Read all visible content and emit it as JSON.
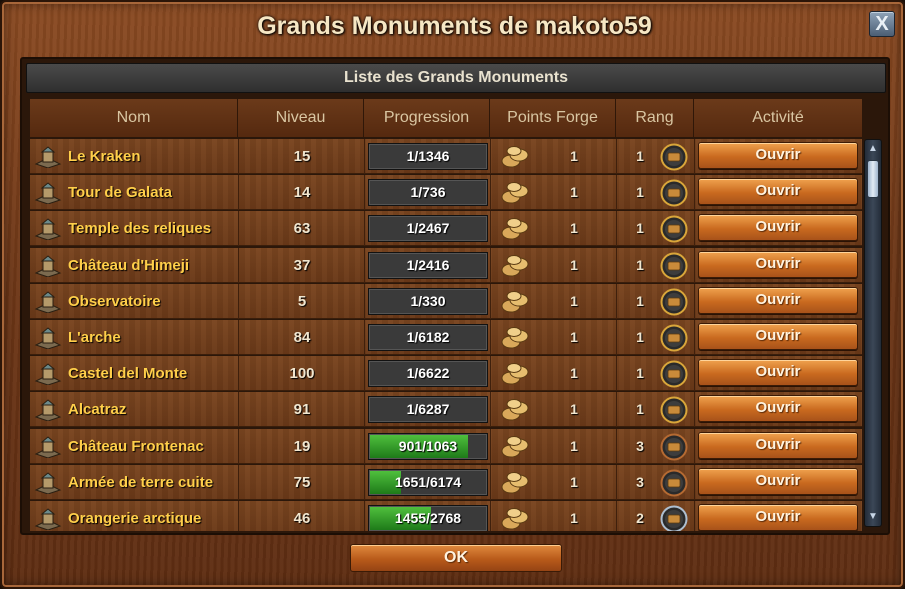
{
  "window": {
    "title": "Grands Monuments de makoto59",
    "close_label": "X"
  },
  "subheader": "Liste des Grands Monuments",
  "columns": {
    "name": "Nom",
    "level": "Niveau",
    "progress": "Progression",
    "forge_points": "Points Forge",
    "rank": "Rang",
    "activity": "Activité"
  },
  "rows": [
    {
      "name": "Le Kraken",
      "level": "15",
      "progress": "1/1346",
      "fill": 0.0,
      "forge_points": "1",
      "rank": "1",
      "button": "Ouvrir",
      "icon": "kraken-icon",
      "medal": "gold"
    },
    {
      "name": "Tour de Galata",
      "level": "14",
      "progress": "1/736",
      "fill": 0.0,
      "forge_points": "1",
      "rank": "1",
      "button": "Ouvrir",
      "icon": "tower-icon",
      "medal": "gold"
    },
    {
      "name": "Temple des reliques",
      "level": "63",
      "progress": "1/2467",
      "fill": 0.0,
      "forge_points": "1",
      "rank": "1",
      "button": "Ouvrir",
      "icon": "temple-icon",
      "medal": "gold"
    },
    {
      "name": "Château d'Himeji",
      "level": "37",
      "progress": "1/2416",
      "fill": 0.0,
      "forge_points": "1",
      "rank": "1",
      "button": "Ouvrir",
      "icon": "castle-icon",
      "medal": "gold"
    },
    {
      "name": "Observatoire",
      "level": "5",
      "progress": "1/330",
      "fill": 0.0,
      "forge_points": "1",
      "rank": "1",
      "button": "Ouvrir",
      "icon": "observatory-icon",
      "medal": "gold"
    },
    {
      "name": "L'arche",
      "level": "84",
      "progress": "1/6182",
      "fill": 0.0,
      "forge_points": "1",
      "rank": "1",
      "button": "Ouvrir",
      "icon": "arch-icon",
      "medal": "gold"
    },
    {
      "name": "Castel del Monte",
      "level": "100",
      "progress": "1/6622",
      "fill": 0.0,
      "forge_points": "1",
      "rank": "1",
      "button": "Ouvrir",
      "icon": "fortress-icon",
      "medal": "gold"
    },
    {
      "name": "Alcatraz",
      "level": "91",
      "progress": "1/6287",
      "fill": 0.0,
      "forge_points": "1",
      "rank": "1",
      "button": "Ouvrir",
      "icon": "prison-icon",
      "medal": "gold"
    },
    {
      "name": "Château Frontenac",
      "level": "19",
      "progress": "901/1063",
      "fill": 0.848,
      "forge_points": "1",
      "rank": "3",
      "button": "Ouvrir",
      "icon": "hotel-castle-icon",
      "medal": "bronze"
    },
    {
      "name": "Armée de terre cuite",
      "level": "75",
      "progress": "1651/6174",
      "fill": 0.267,
      "forge_points": "1",
      "rank": "3",
      "button": "Ouvrir",
      "icon": "terracotta-icon",
      "medal": "bronze"
    },
    {
      "name": "Orangerie arctique",
      "level": "46",
      "progress": "1455/2768",
      "fill": 0.526,
      "forge_points": "1",
      "rank": "2",
      "button": "Ouvrir",
      "icon": "orangery-icon",
      "medal": "silver"
    }
  ],
  "ok_label": "OK",
  "colors": {
    "name_text": "#ffcf4a",
    "progress_fill": "#2e9a27",
    "medal_gold": "#d9a63a",
    "medal_silver": "#aebfd0",
    "medal_bronze": "#b56a32"
  }
}
